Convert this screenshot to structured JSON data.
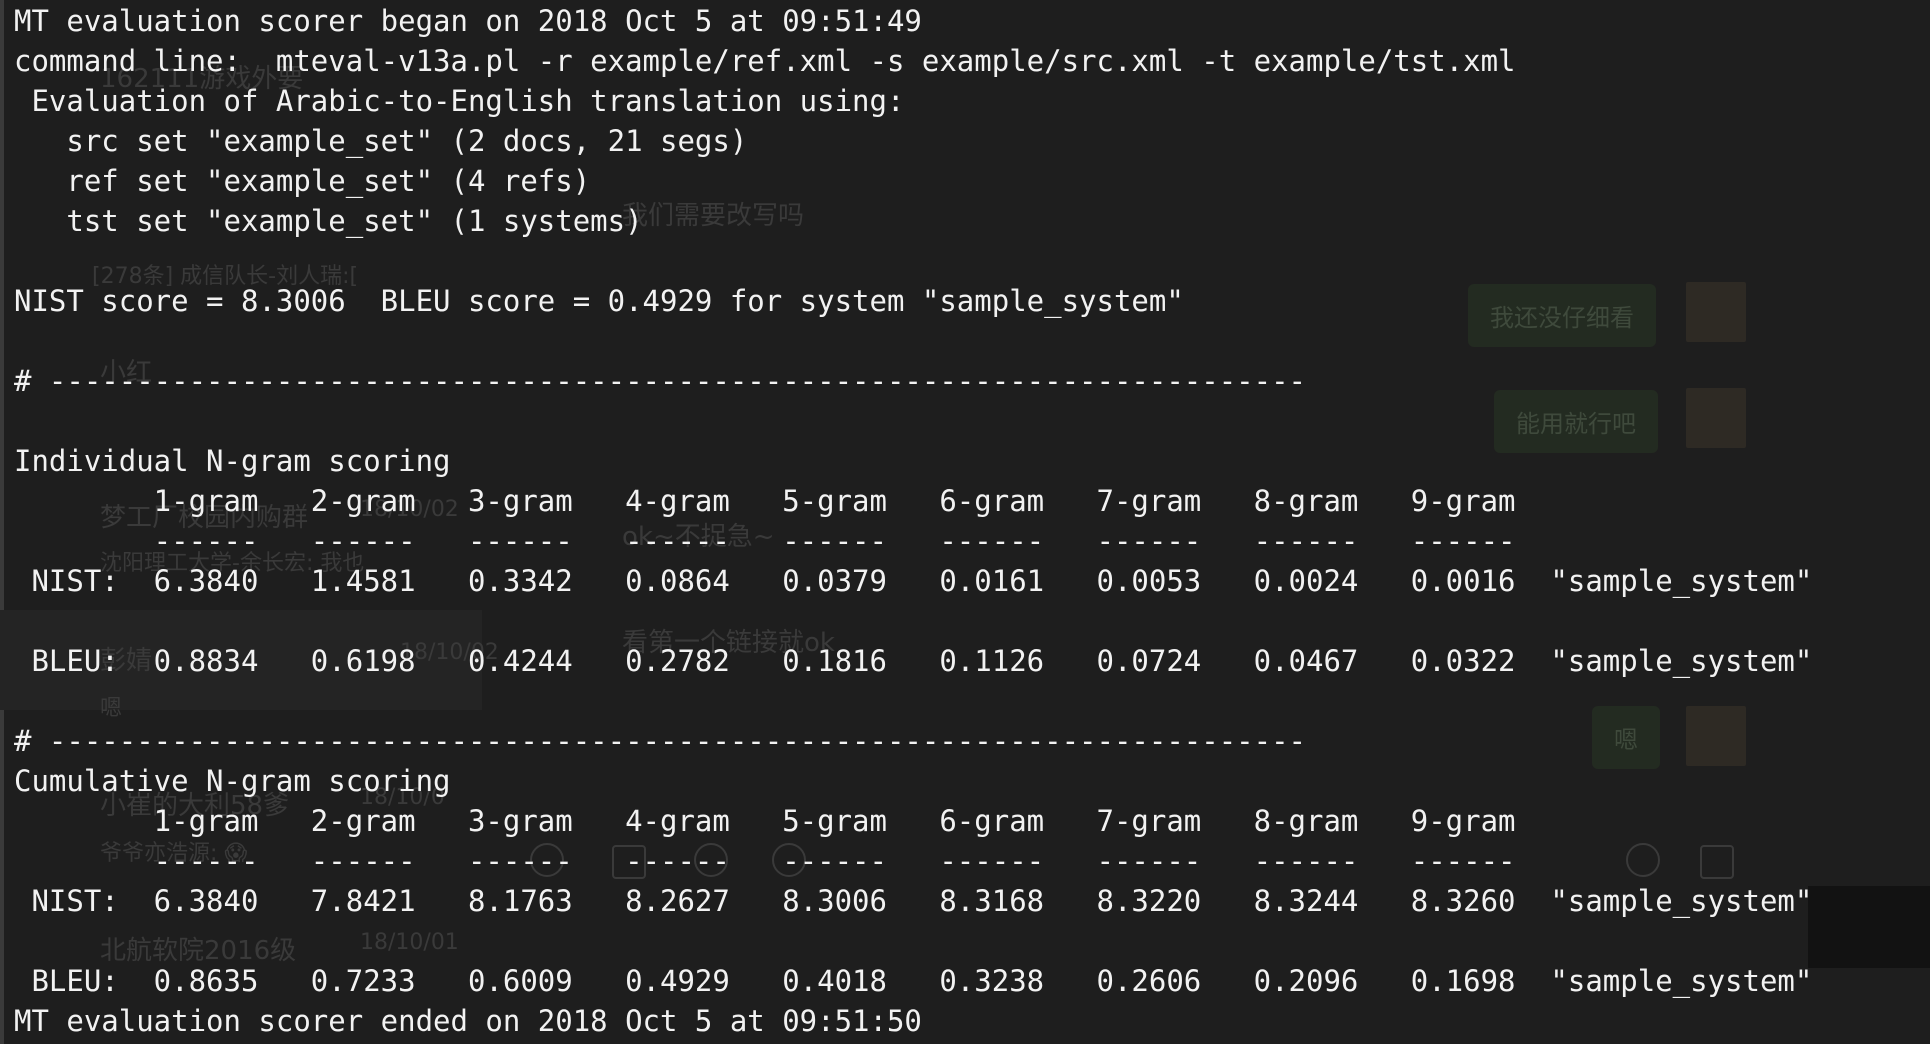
{
  "terminal": {
    "header": {
      "start": "MT evaluation scorer began on 2018 Oct 5 at 09:51:49",
      "command": "command line:  mteval-v13a.pl -r example/ref.xml -s example/src.xml -t example/tst.xml",
      "eval_of": " Evaluation of Arabic-to-English translation using:",
      "src_set": "   src set \"example_set\" (2 docs, 21 segs)",
      "ref_set": "   ref set \"example_set\" (4 refs)",
      "tst_set": "   tst set \"example_set\" (1 systems)"
    },
    "score_line": "NIST score = 8.3006  BLEU score = 0.4929 for system \"sample_system\"",
    "separator_1": "# ------------------------------------------------------------------------",
    "individual": {
      "title": "Individual N-gram scoring",
      "header": "        1-gram   2-gram   3-gram   4-gram   5-gram   6-gram   7-gram   8-gram   9-gram",
      "dashes": "        ------   ------   ------   ------   ------   ------   ------   ------   ------",
      "nist": " NIST:  6.3840   1.4581   0.3342   0.0864   0.0379   0.0161   0.0053   0.0024   0.0016  \"sample_system\"",
      "bleu": " BLEU:  0.8834   0.6198   0.4244   0.2782   0.1816   0.1126   0.0724   0.0467   0.0322  \"sample_system\""
    },
    "separator_2": "# ------------------------------------------------------------------------",
    "cumulative": {
      "title": "Cumulative N-gram scoring",
      "header": "        1-gram   2-gram   3-gram   4-gram   5-gram   6-gram   7-gram   8-gram   9-gram",
      "dashes": "        ------   ------   ------   ------   ------   ------   ------   ------   ------",
      "nist": " NIST:  6.3840   7.8421   8.1763   8.2627   8.3006   8.3168   8.3220   8.3244   8.3260  \"sample_system\"",
      "bleu": " BLEU:  0.8635   0.7233   0.6009   0.4929   0.4018   0.3238   0.2606   0.2096   0.1698  \"sample_system\""
    },
    "end": "MT evaluation scorer ended on 2018 Oct 5 at 09:51:50"
  },
  "background_chat": {
    "chat_items": [
      {
        "name": "162111游戏外要"
      },
      {
        "name": "我们需要改写吗"
      },
      {
        "name": "[278条] 成信队长-刘人瑞:["
      },
      {
        "name": "小红"
      },
      {
        "name": "梦工厂校园内购群"
      },
      {
        "name": "沈阳理工大学-余长宏: 我也"
      },
      {
        "name": "彭婧"
      },
      {
        "name": "嗯"
      },
      {
        "name": "小崔的大利58爹"
      },
      {
        "name": "爷爷亦浩源: 😱"
      },
      {
        "name": "北航软院2016级"
      }
    ],
    "chat_dates": [
      "18/10/02",
      "18/10/02",
      "18/10/0",
      "18/10/01"
    ],
    "messages": [
      {
        "text": "ok~不捉急~"
      },
      {
        "text": "看第一个链接就ok"
      }
    ],
    "bubbles": [
      {
        "text": "我还没仔细看"
      },
      {
        "text": "能用就行吧"
      },
      {
        "text": "嗯"
      }
    ],
    "colors": {
      "terminal_bg": "#1e1e1e",
      "terminal_text": "#f2f2f2",
      "ghost_text": "#3a3a3a",
      "bubble_bg": "#232b21"
    }
  }
}
